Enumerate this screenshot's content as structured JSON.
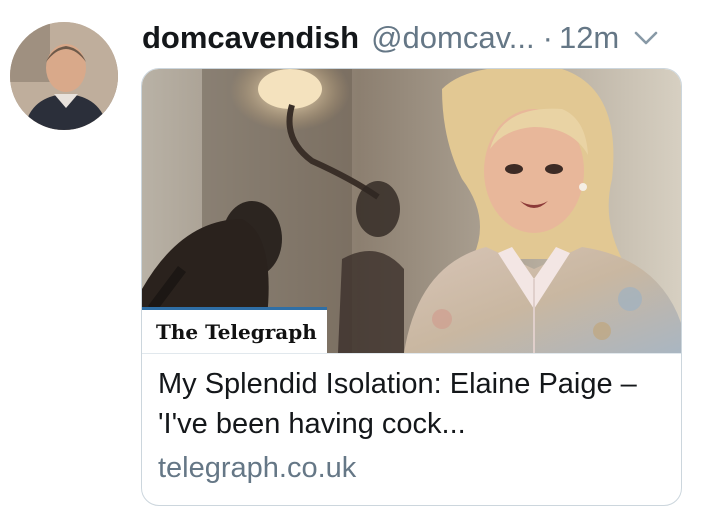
{
  "tweet": {
    "display_name": "domcavendish",
    "handle": "@domcav...",
    "separator": "·",
    "time": "12m"
  },
  "card": {
    "brand": "The Telegraph",
    "title": "My Splendid Isolation: Elaine Paige – 'I've been having cock...",
    "domain": "telegraph.co.uk"
  },
  "icons": {
    "menu": "chevron-down-icon"
  },
  "colors": {
    "text_primary": "#14171a",
    "text_secondary": "#657786",
    "card_border": "#ccd6dd"
  }
}
